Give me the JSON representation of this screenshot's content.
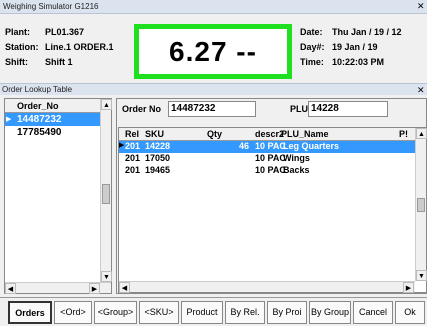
{
  "window": {
    "title": "Weighing Simulator  G1216"
  },
  "info": {
    "plant_label": "Plant:",
    "plant_value": "PL01.367",
    "station_label": "Station:",
    "station_value": "Line.1 ORDER.1",
    "shift_label": "Shift:",
    "shift_value": "Shift 1",
    "date_label": "Date:",
    "date_value": "Thu Jan / 19 / 12",
    "day_label": "Day#:",
    "day_value": "19   Jan / 19",
    "time_label": "Time:",
    "time_value": "10:22:03 PM"
  },
  "weight": {
    "display": "6.27 --",
    "border_color": "#1ee01e"
  },
  "lookup": {
    "title": "Order Lookup Table"
  },
  "orders": {
    "header": "Order_No",
    "rows": [
      "14487232",
      "17785490"
    ]
  },
  "detail": {
    "order_label": "Order  No",
    "order_value": "14487232",
    "plu_label": "PLU",
    "plu_value": "14228"
  },
  "grid": {
    "columns": [
      "Rel",
      "SKU",
      "Qty",
      "descr2",
      "PLU_Name",
      "P!"
    ],
    "rows": [
      {
        "rel": "201",
        "sku": "14228",
        "qty": "46",
        "descr2": "10 PAC",
        "plu_name": "Leg Quarters"
      },
      {
        "rel": "201",
        "sku": "17050",
        "qty": "",
        "descr2": "10 PAC",
        "plu_name": "Wings"
      },
      {
        "rel": "201",
        "sku": "19465",
        "qty": "",
        "descr2": "10 PAC",
        "plu_name": "Backs"
      }
    ]
  },
  "buttons": [
    "Orders",
    "<Ord>",
    "<Group>",
    "<SKU>",
    "Product",
    "By Rel.",
    "By Proi",
    "By Group",
    "Cancel",
    "Ok"
  ],
  "icons": {
    "close": "close-icon",
    "row_pointer": "row-pointer-icon"
  }
}
